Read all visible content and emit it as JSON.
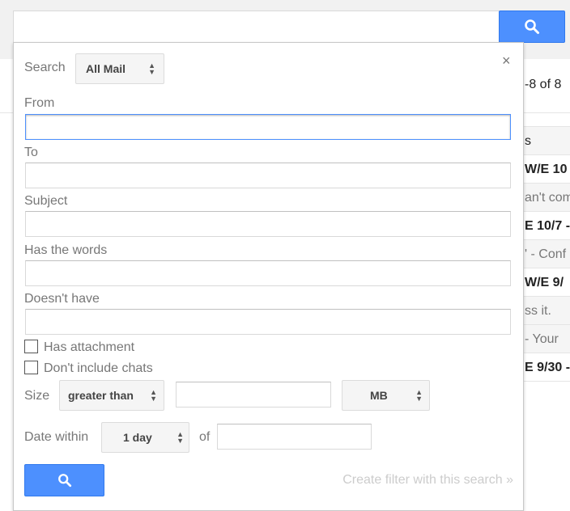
{
  "search_bar": {
    "value": "",
    "icon": "search-icon"
  },
  "pager": {
    "count": "-8 of 8"
  },
  "list": {
    "header": "s",
    "rows": [
      {
        "text": "W/E 10",
        "bold": true
      },
      {
        "text": "an't com",
        "bold": false
      },
      {
        "text": "E 10/7 -",
        "bold": true
      },
      {
        "text": "' - Conf",
        "bold": false
      },
      {
        "text": "W/E 9/",
        "bold": true
      },
      {
        "text": "ss it.",
        "bold": false
      },
      {
        "text": "- Your",
        "bold": false
      },
      {
        "text": "E 9/30 -",
        "bold": true
      }
    ]
  },
  "panel": {
    "close": "×",
    "search_label": "Search",
    "search_scope": "All Mail",
    "from_label": "From",
    "from_value": "",
    "to_label": "To",
    "to_value": "",
    "subject_label": "Subject",
    "subject_value": "",
    "has_words_label": "Has the words",
    "has_words_value": "",
    "doesnt_have_label": "Doesn't have",
    "doesnt_have_value": "",
    "has_attachment": {
      "label": "Has attachment",
      "checked": false
    },
    "no_chats": {
      "label": "Don't include chats",
      "checked": false
    },
    "size_label": "Size",
    "size_op": "greater than",
    "size_value": "",
    "size_unit": "MB",
    "date_label": "Date within",
    "date_range": "1 day",
    "of_label": "of",
    "date_value": "",
    "filter_link": "Create filter with this search »"
  },
  "colors": {
    "accent": "#4d90fe"
  }
}
